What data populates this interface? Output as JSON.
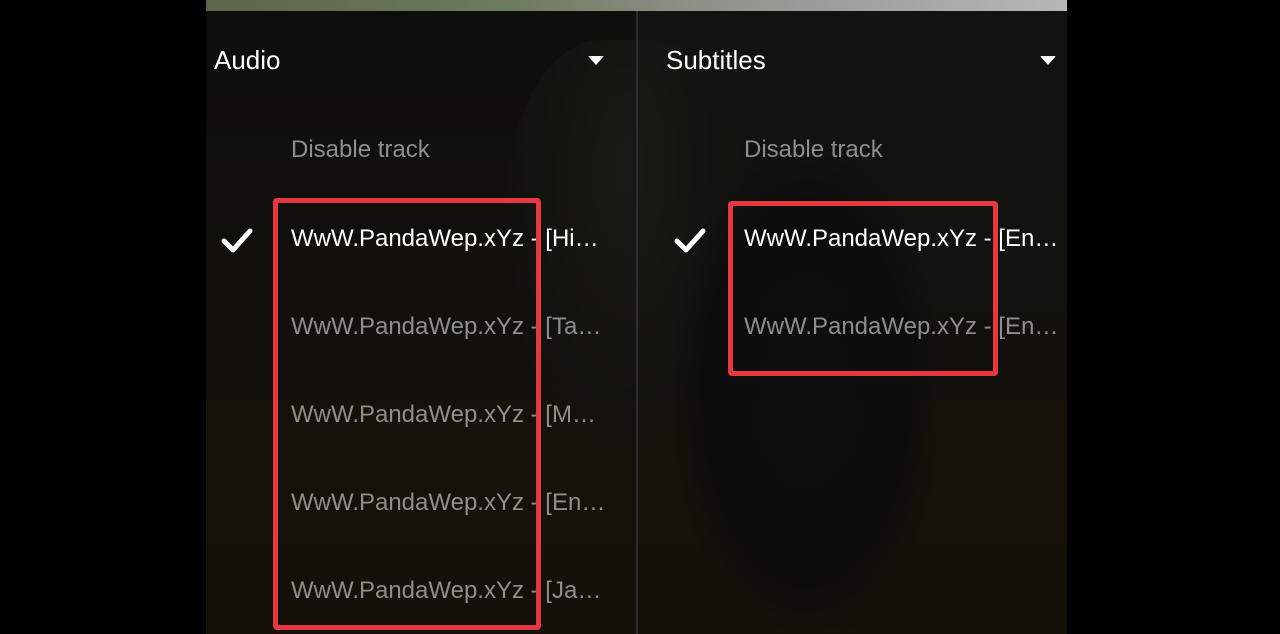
{
  "audio": {
    "title": "Audio",
    "disable_label": "Disable track",
    "tracks": [
      {
        "label": "WwW.PandaWep.xYz - [Hin…",
        "selected": true
      },
      {
        "label": "WwW.PandaWep.xYz - [Ta…",
        "selected": false
      },
      {
        "label": "WwW.PandaWep.xYz - [Mal…",
        "selected": false
      },
      {
        "label": "WwW.PandaWep.xYz - [Eng…",
        "selected": false
      },
      {
        "label": "WwW.PandaWep.xYz - [Jap…",
        "selected": false
      }
    ]
  },
  "subtitles": {
    "title": "Subtitles",
    "disable_label": "Disable track",
    "tracks": [
      {
        "label": "WwW.PandaWep.xYz - [Eng…",
        "selected": true
      },
      {
        "label": "WwW.PandaWep.xYz - [Eng…",
        "selected": false
      }
    ]
  },
  "icons": {
    "dropdown": "caret-down-icon",
    "selected": "checkmark-icon"
  },
  "colors": {
    "highlight": "#e8383f",
    "selected_text": "#ffffff",
    "unselected_text": "#8e8e8e"
  }
}
